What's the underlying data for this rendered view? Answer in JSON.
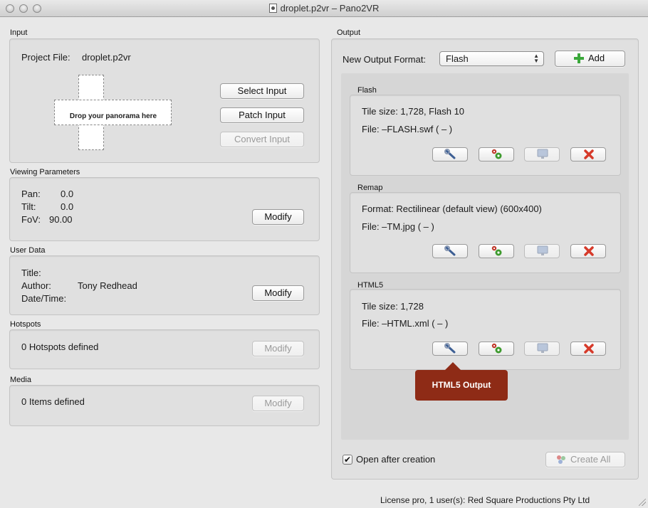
{
  "window": {
    "title": "droplet.p2vr  – Pano2VR"
  },
  "input": {
    "section": "Input",
    "project_label": "Project File:",
    "project_file": "droplet.p2vr",
    "drop_hint": "Drop your panorama here",
    "select_input": "Select Input",
    "patch_input": "Patch Input",
    "convert_input": "Convert Input"
  },
  "viewing": {
    "section": "Viewing Parameters",
    "pan_label": "Pan:",
    "pan_value": "0.0",
    "tilt_label": "Tilt:",
    "tilt_value": "0.0",
    "fov_label": "FoV:",
    "fov_value": "90.00",
    "modify": "Modify"
  },
  "user_data": {
    "section": "User Data",
    "title_label": "Title:",
    "author_label": "Author:",
    "author_value": "Tony Redhead",
    "datetime_label": "Date/Time:",
    "modify": "Modify"
  },
  "hotspots": {
    "section": "Hotspots",
    "summary": "0 Hotspots defined",
    "modify": "Modify"
  },
  "media": {
    "section": "Media",
    "summary": "0 Items defined",
    "modify": "Modify"
  },
  "output": {
    "section": "Output",
    "format_label": "New Output Format:",
    "format_value": "Flash",
    "add": "Add",
    "flash": {
      "title": "Flash",
      "line1": "Tile size: 1,728, Flash 10",
      "line2": "File: –FLASH.swf ( – )"
    },
    "remap": {
      "title": "Remap",
      "line1": "Format: Rectilinear (default view) (600x400)",
      "line2": "File: –TM.jpg ( – )"
    },
    "html5": {
      "title": "HTML5",
      "line1": "Tile size: 1,728",
      "line2": "File: –HTML.xml ( – )"
    },
    "tooltip": "HTML5 Output",
    "open_after": "Open after creation",
    "open_after_checked": true,
    "create_all": "Create All"
  },
  "status": {
    "license": "License pro, 1 user(s): Red Square Productions Pty Ltd"
  },
  "colors": {
    "tooltip": "#8e2b16",
    "add_icon": "#3aa83a",
    "delete_icon": "#d63a2a"
  },
  "icons": {
    "edit": "wrench-icon",
    "generate": "gears-icon",
    "preview": "monitor-icon",
    "delete": "delete-icon",
    "add": "plus-icon",
    "create_all": "create-all-icon"
  }
}
